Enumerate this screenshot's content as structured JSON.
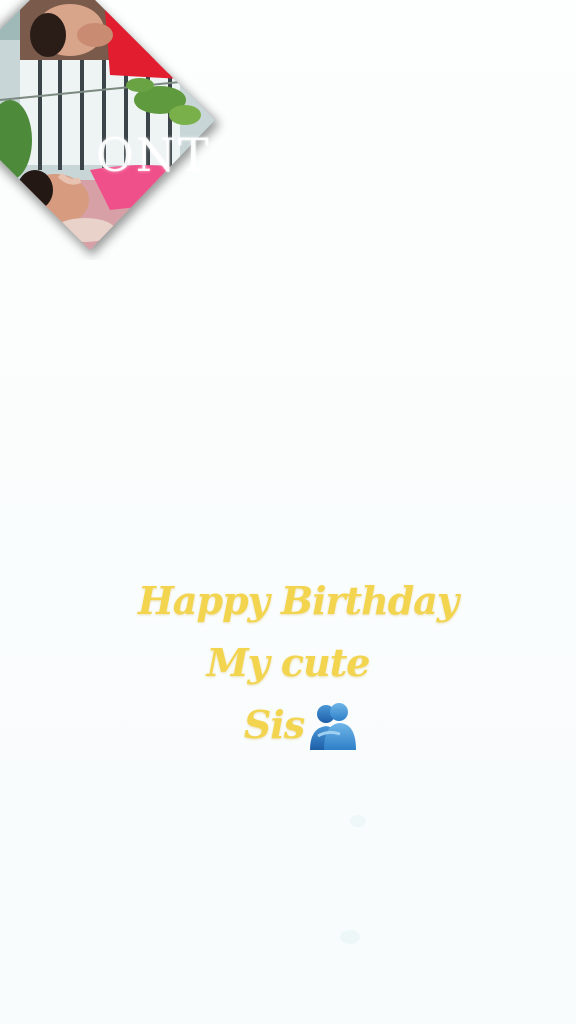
{
  "overlay": {
    "text": "ONT"
  },
  "greeting": {
    "line1": "Happy Birthday",
    "line2": "My cute",
    "line3": "Sis"
  },
  "icons": {
    "hug": "people-hugging-icon"
  },
  "colors": {
    "background": "#fbfdfd",
    "greeting_text": "#f2d44f",
    "hug_icon": "#2f7fc8",
    "frame_shadow": "#555555"
  }
}
